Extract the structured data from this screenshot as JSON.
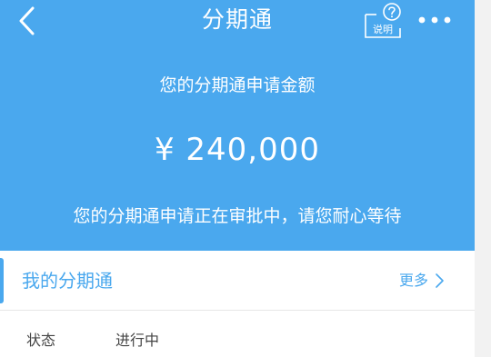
{
  "nav": {
    "title": "分期通",
    "help_label": "说明"
  },
  "summary": {
    "caption": "您的分期通申请金额",
    "amount": "¥ 240,000",
    "status_message": "您的分期通申请正在审批中，请您耐心等待"
  },
  "section": {
    "title": "我的分期通",
    "more_label": "更多"
  },
  "details": [
    {
      "label": "状态",
      "value": "进行中"
    }
  ],
  "colors": {
    "primary": "#4aa8ee",
    "text_on_primary": "#ffffff",
    "body_text": "#444444",
    "divider": "#e6e6e6"
  },
  "icons": {
    "back": "chevron-left-icon",
    "help": "question-circle-icon",
    "menu": "more-horizontal-icon",
    "more": "chevron-right-icon"
  }
}
